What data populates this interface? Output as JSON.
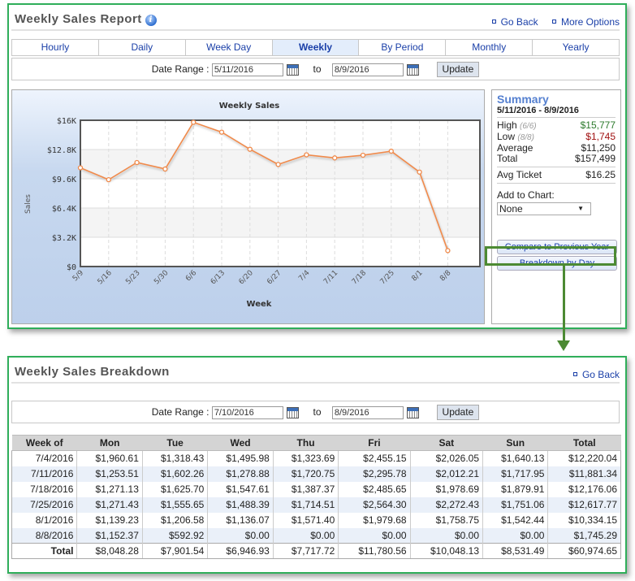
{
  "report": {
    "title": "Weekly Sales Report",
    "links": [
      "Go Back",
      "More Options"
    ],
    "tabs": [
      {
        "label": "Hourly",
        "active": false
      },
      {
        "label": "Daily",
        "active": false
      },
      {
        "label": "Week Day",
        "active": false
      },
      {
        "label": "Weekly",
        "active": true
      },
      {
        "label": "By Period",
        "active": false
      },
      {
        "label": "Monthly",
        "active": false
      },
      {
        "label": "Yearly",
        "active": false
      }
    ],
    "date_range": {
      "label": "Date Range :",
      "from": "5/11/2016",
      "to_label": "to",
      "to": "8/9/2016",
      "update_label": "Update"
    }
  },
  "chart_data": {
    "type": "line",
    "title": "Weekly Sales",
    "xlabel": "Week",
    "ylabel": "Sales",
    "categories": [
      "5/9",
      "5/16",
      "5/23",
      "5/30",
      "6/6",
      "6/13",
      "6/20",
      "6/27",
      "7/4",
      "7/11",
      "7/18",
      "7/25",
      "8/1",
      "8/8"
    ],
    "series": [
      {
        "name": "Sales",
        "color": "#f08a4b",
        "values": [
          10800,
          9500,
          11380,
          10670,
          15777,
          14700,
          12830,
          11170,
          12220.04,
          11881.34,
          12176.06,
          12617.77,
          10334.15,
          1745.29
        ]
      }
    ],
    "ylim": [
      0,
      16000
    ],
    "yticks": [
      0,
      3200,
      6400,
      9600,
      12800,
      16000
    ],
    "ytick_labels": [
      "$0",
      "$3.2K",
      "$6.4K",
      "$9.6K",
      "$12.8K",
      "$16K"
    ],
    "grid": true,
    "legend": "none"
  },
  "summary": {
    "title": "Summary",
    "range": "5/11/2016 - 8/9/2016",
    "high_label": "High",
    "high_date": "(6/6)",
    "high_value": "$15,777",
    "low_label": "Low",
    "low_date": "(8/8)",
    "low_value": "$1,745",
    "average_label": "Average",
    "average_value": "$11,250",
    "total_label": "Total",
    "total_value": "$157,499",
    "avg_ticket_label": "Avg Ticket",
    "avg_ticket_value": "$16.25",
    "add_to_chart_label": "Add to Chart:",
    "add_to_chart_selected": "None",
    "compare_button": "Compare to Previous Year",
    "breakdown_button": "Breakdown by Day"
  },
  "breakdown": {
    "title": "Weekly Sales Breakdown",
    "go_back": "Go Back",
    "date_range": {
      "label": "Date Range :",
      "from": "7/10/2016",
      "to_label": "to",
      "to": "8/9/2016",
      "update_label": "Update"
    },
    "columns": [
      "Week of",
      "Mon",
      "Tue",
      "Wed",
      "Thu",
      "Fri",
      "Sat",
      "Sun",
      "Total"
    ],
    "rows": [
      [
        "7/4/2016",
        "$1,960.61",
        "$1,318.43",
        "$1,495.98",
        "$1,323.69",
        "$2,455.15",
        "$2,026.05",
        "$1,640.13",
        "$12,220.04"
      ],
      [
        "7/11/2016",
        "$1,253.51",
        "$1,602.26",
        "$1,278.88",
        "$1,720.75",
        "$2,295.78",
        "$2,012.21",
        "$1,717.95",
        "$11,881.34"
      ],
      [
        "7/18/2016",
        "$1,271.13",
        "$1,625.70",
        "$1,547.61",
        "$1,387.37",
        "$2,485.65",
        "$1,978.69",
        "$1,879.91",
        "$12,176.06"
      ],
      [
        "7/25/2016",
        "$1,271.43",
        "$1,555.65",
        "$1,488.39",
        "$1,714.51",
        "$2,564.30",
        "$2,272.43",
        "$1,751.06",
        "$12,617.77"
      ],
      [
        "8/1/2016",
        "$1,139.23",
        "$1,206.58",
        "$1,136.07",
        "$1,571.40",
        "$1,979.68",
        "$1,758.75",
        "$1,542.44",
        "$10,334.15"
      ],
      [
        "8/8/2016",
        "$1,152.37",
        "$592.92",
        "$0.00",
        "$0.00",
        "$0.00",
        "$0.00",
        "$0.00",
        "$1,745.29"
      ]
    ],
    "total_row": [
      "Total",
      "$8,048.28",
      "$7,901.54",
      "$6,946.93",
      "$7,717.72",
      "$11,780.56",
      "$10,048.13",
      "$8,531.49",
      "$60,974.65"
    ]
  }
}
